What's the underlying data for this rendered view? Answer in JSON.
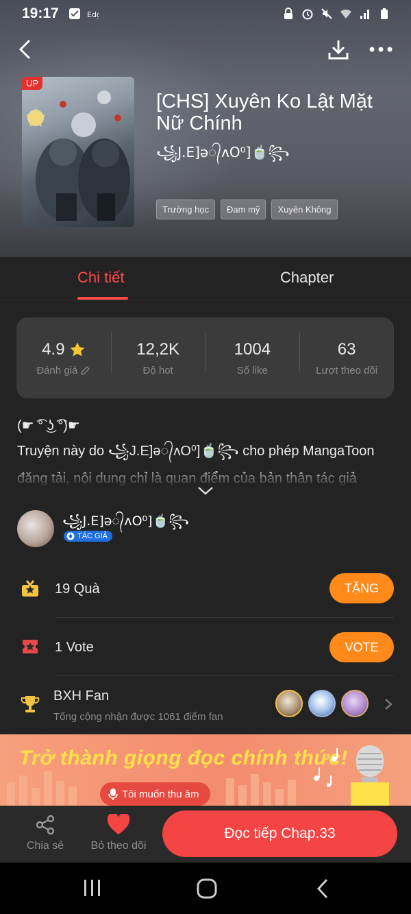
{
  "status": {
    "time": "19:17",
    "left_icons": [
      "check-icon",
      "edge-app-icon"
    ],
    "right_icons": [
      "lock-icon",
      "alarm-icon",
      "mute-icon",
      "wifi-icon",
      "signal-icon",
      "battery-icon"
    ]
  },
  "topbar": {
    "back_icon": "chevron-left-icon",
    "download_icon": "download-icon",
    "more_icon": "more-dots-icon"
  },
  "book": {
    "badge": "UP",
    "title": "[CHS] Xuyên Ko Lật Mặt Nữ Chính",
    "author_display": "꧁J.E]ə᭄ʌO⁰]🍵꧂",
    "tags": [
      "Trường học",
      "Đam mỹ",
      "Xuyên Không"
    ]
  },
  "tabs": {
    "detail": "Chi tiết",
    "chapter": "Chapter"
  },
  "stats": [
    {
      "value": "4.9",
      "label": "Đánh giá",
      "icon": "star-icon"
    },
    {
      "value": "12,2K",
      "label": "Độ hot"
    },
    {
      "value": "1004",
      "label": "Số like"
    },
    {
      "value": "63",
      "label": "Lượt theo dõi"
    }
  ],
  "description": {
    "line1": "(☛ ͡° ͜ʖ ͡°)☛",
    "line2": "Truyện này do ꧁J.E]ə᭄ʌO⁰]🍵꧂ cho phép MangaToon",
    "line3": "đăng tải, nội dung chỉ là quan điểm của bản thân tác giả"
  },
  "author": {
    "name": "꧁J.E]ə᭄ʌO⁰]🍵꧂",
    "badge": "TÁC GIẢ"
  },
  "gift": {
    "label": "19 Quà",
    "button": "TẶNG"
  },
  "vote": {
    "label": "1 Vote",
    "button": "VOTE"
  },
  "fan": {
    "title": "BXH Fan",
    "subtitle": "Tổng cộng nhận được 1061 điểm fan"
  },
  "banner": {
    "headline": "Trở thành giọng đọc chính thức!",
    "button": "Tôi muốn thu âm"
  },
  "bottom": {
    "share": "Chia sẻ",
    "unfollow": "Bỏ theo dõi",
    "read": "Đọc tiếp Chap.33"
  },
  "colors": {
    "accent_red": "#ff4a4a",
    "orange": "#ff8a1a",
    "banner_yellow": "#ffe14a"
  }
}
